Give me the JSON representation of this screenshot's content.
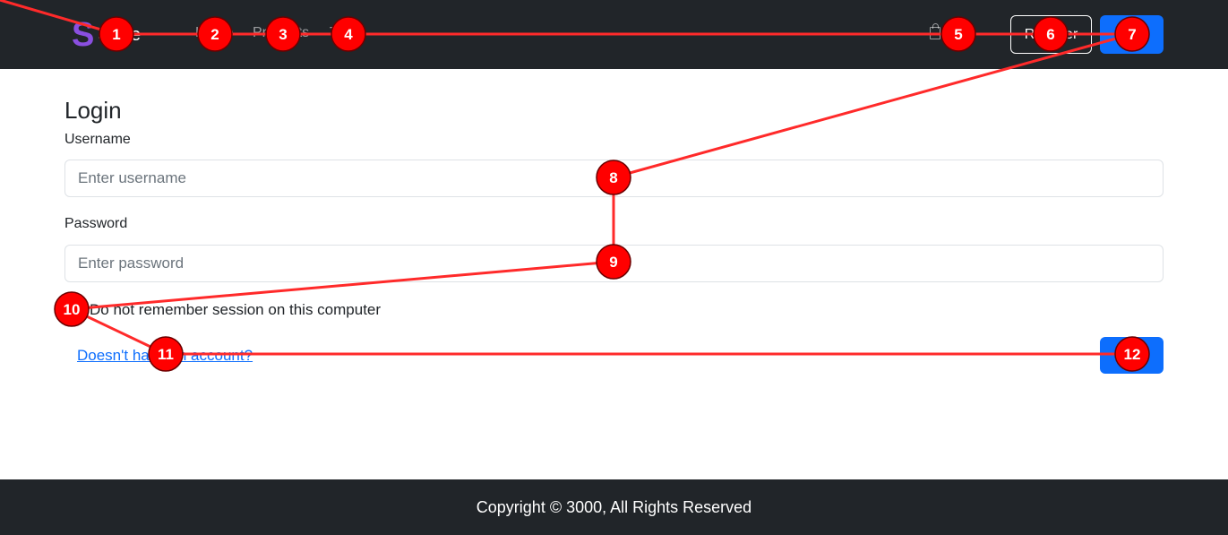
{
  "navbar": {
    "brand_letter": "S",
    "brand_text": "Store",
    "links": [
      {
        "label": "Home"
      },
      {
        "label": "Products"
      },
      {
        "label": "Tags"
      }
    ],
    "cart_label": "Cart",
    "cart_icon": "shopping-bag-icon",
    "register_label": "Register",
    "login_label": "Login"
  },
  "form": {
    "title": "Login",
    "username_label": "Username",
    "username_placeholder": "Enter username",
    "password_label": "Password",
    "password_placeholder": "Enter password",
    "remember_label": "Do not remember session on this computer",
    "register_link": "Doesn't have an account?",
    "submit_label": "Login"
  },
  "footer": {
    "copyright": "Copyright © 3000, All Rights Reserved"
  },
  "annotations": {
    "color": "#ff0000",
    "markers": [
      "1",
      "2",
      "3",
      "4",
      "5",
      "6",
      "7",
      "8",
      "9",
      "10",
      "11",
      "12"
    ]
  },
  "colors": {
    "navbar_bg": "#212529",
    "primary": "#0d6efd",
    "brand": "#8a4fe0"
  }
}
